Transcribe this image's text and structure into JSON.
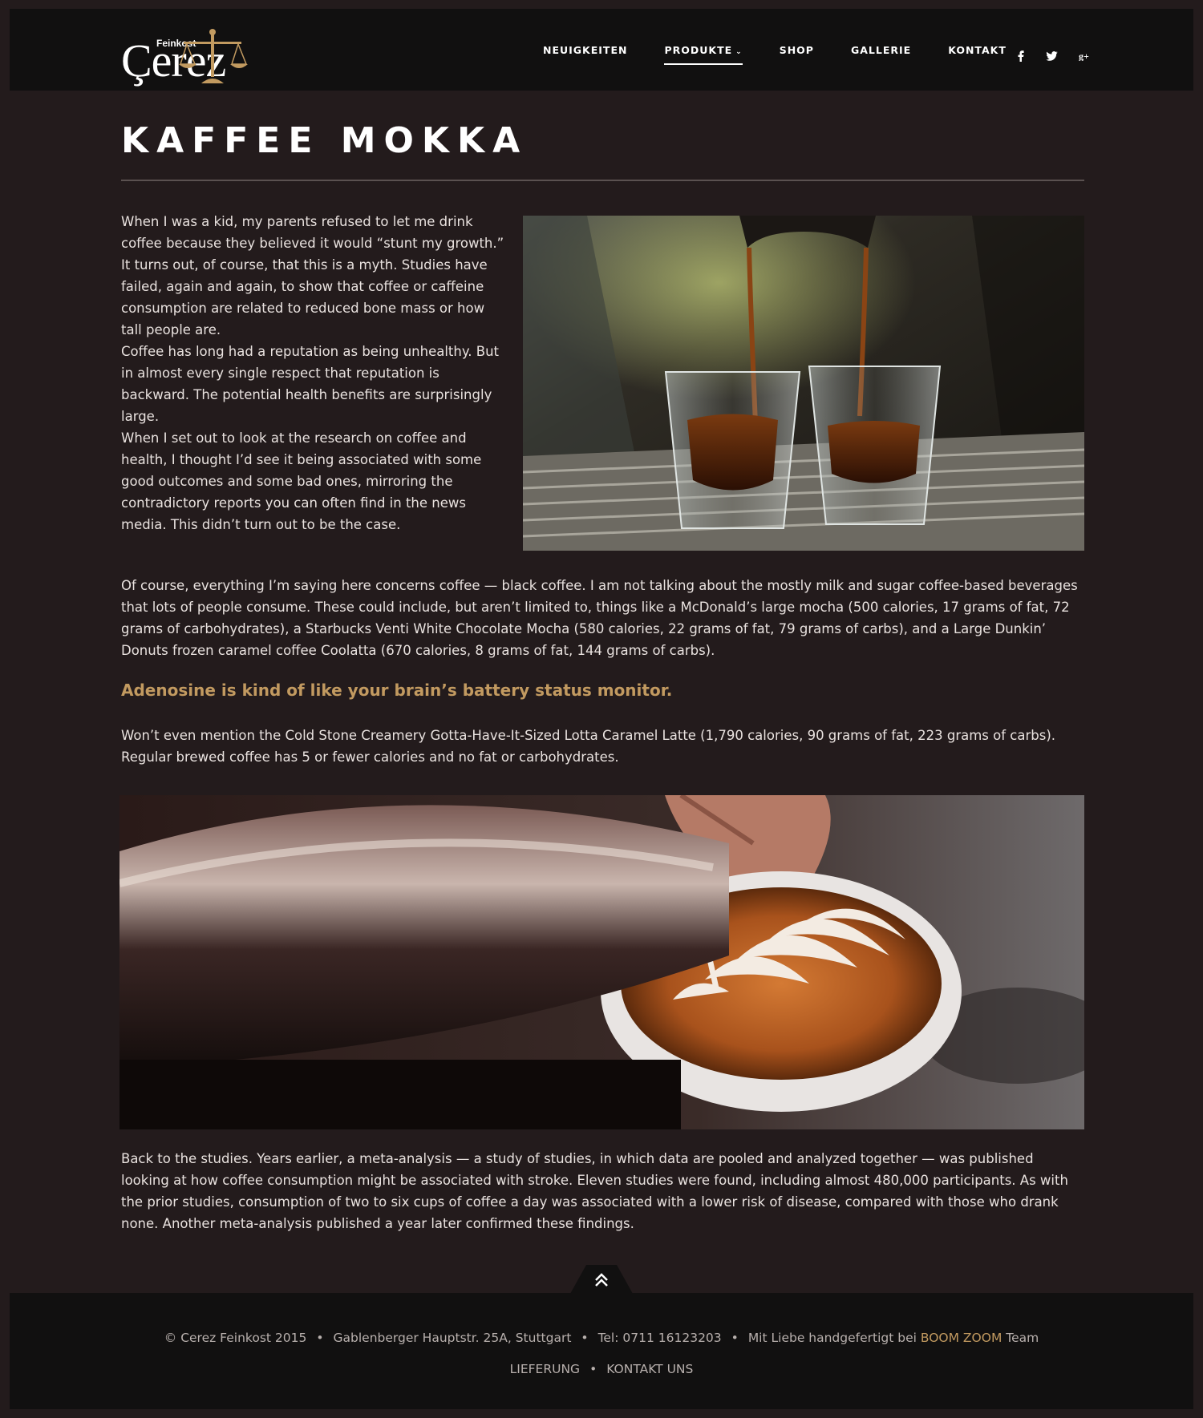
{
  "brand": {
    "small": "Feinkost",
    "name": "Çerez"
  },
  "nav": {
    "items": [
      {
        "label": "NEUIGKEITEN"
      },
      {
        "label": "PRODUKTE"
      },
      {
        "label": "SHOP"
      },
      {
        "label": "GALLERIE"
      },
      {
        "label": "KONTAKT"
      }
    ],
    "active_index": 1
  },
  "social": [
    {
      "icon": "facebook-icon",
      "glyph": "f"
    },
    {
      "icon": "twitter-icon",
      "glyph": "t"
    },
    {
      "icon": "google-plus-icon",
      "glyph": "g+"
    }
  ],
  "article": {
    "title": "KAFFEE MOKKA",
    "p1": "When I was a kid, my parents refused to let me drink coffee because they believed it would “stunt my growth.” It turns out, of course, that this is a myth. Studies have failed, again and again, to show that coffee or caffeine consumption are related to reduced bone mass or how tall people are.",
    "p2": "Coffee has long had a reputation as being unhealthy. But in almost every single respect that reputation is backward. The potential health benefits are surprisingly large.",
    "p3": "When I set out to look at the research on coffee and health, I thought I’d see it being associated with some good outcomes and some bad ones, mirroring the contradictory reports you can often find in the news media. This didn’t turn out to be the case.",
    "p4": "Of course, everything I’m saying here concerns coffee — black coffee. I am not talking about the mostly milk and sugar coffee-based beverages that lots of people consume. These could include, but aren’t limited to, things like a McDonald’s large mocha (500 calories, 17 grams of fat, 72 grams of carbohydrates), a Starbucks Venti White Chocolate Mocha (580 calories, 22 grams of fat, 79 grams of carbs), and a Large Dunkin’ Donuts frozen caramel coffee Coolatta (670 calories, 8 grams of fat, 144 grams of carbs).",
    "quote": "Adenosine is kind of like your brain’s battery status monitor.",
    "p5": "Won’t even mention the Cold Stone Creamery Gotta-Have-It-Sized Lotta Caramel Latte (1,790 calories, 90 grams of fat, 223 grams of carbs). Regular brewed coffee has 5 or fewer calories and no fat or carbohydrates.",
    "p6": "Back to the studies. Years earlier, a meta-analysis — a study of studies, in which data are pooled and analyzed together — was published looking at how coffee consumption might be associated with stroke. Eleven studies were found, including almost 480,000 participants. As with the prior studies, consump­tion of two to six cups of coffee a day was associated with a lower risk of disease, compared with those who drank none. Another meta-analysis published a year later confirmed these findings."
  },
  "footer": {
    "copyright": "© Cerez Feinkost 2015",
    "address": "Gablenberger Hauptstr. 25A, Stuttgart",
    "phone": "Tel: 0711 16123203",
    "credit_prefix": "Mit Liebe handgefertigt bei",
    "credit_brand": "BOOM ZOOM",
    "credit_suffix": "Team",
    "link_delivery": "LIEFERUNG",
    "link_contact": "KONTAKT UNS"
  },
  "colors": {
    "background": "#231b1c",
    "header": "#111010",
    "accent": "#c29a60"
  }
}
